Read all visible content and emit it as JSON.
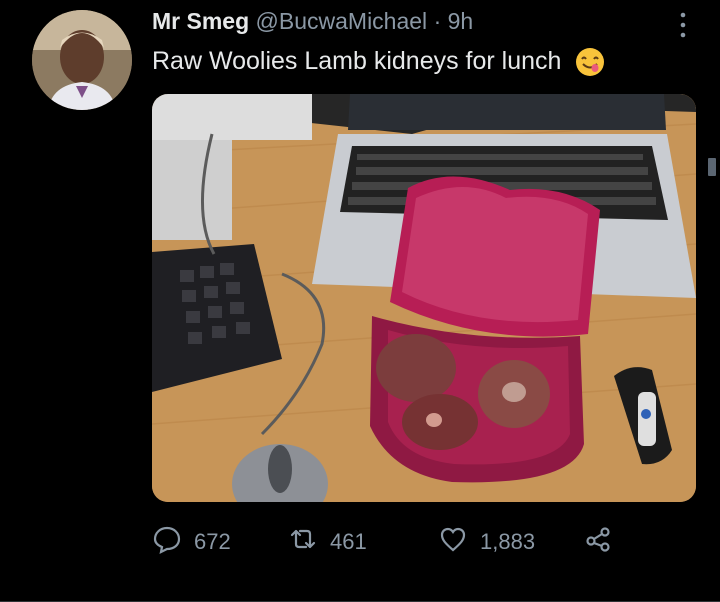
{
  "tweet": {
    "display_name": "Mr Smeg",
    "handle": "@BucwaMichael",
    "separator": "·",
    "time": "9h",
    "text": "Raw Woolies Lamb kidneys for lunch"
  },
  "icons": {
    "more": "more-vertical-icon",
    "emoji": "yum-emoji-icon",
    "reply": "reply-icon",
    "retweet": "retweet-icon",
    "like": "heart-icon",
    "share": "share-icon"
  },
  "metrics": {
    "replies": "672",
    "retweets": "461",
    "likes": "1,883"
  },
  "colors": {
    "background": "#000000",
    "text_primary": "#e7e9ea",
    "text_secondary": "#8b98a5",
    "container": "#9a1e4f"
  }
}
